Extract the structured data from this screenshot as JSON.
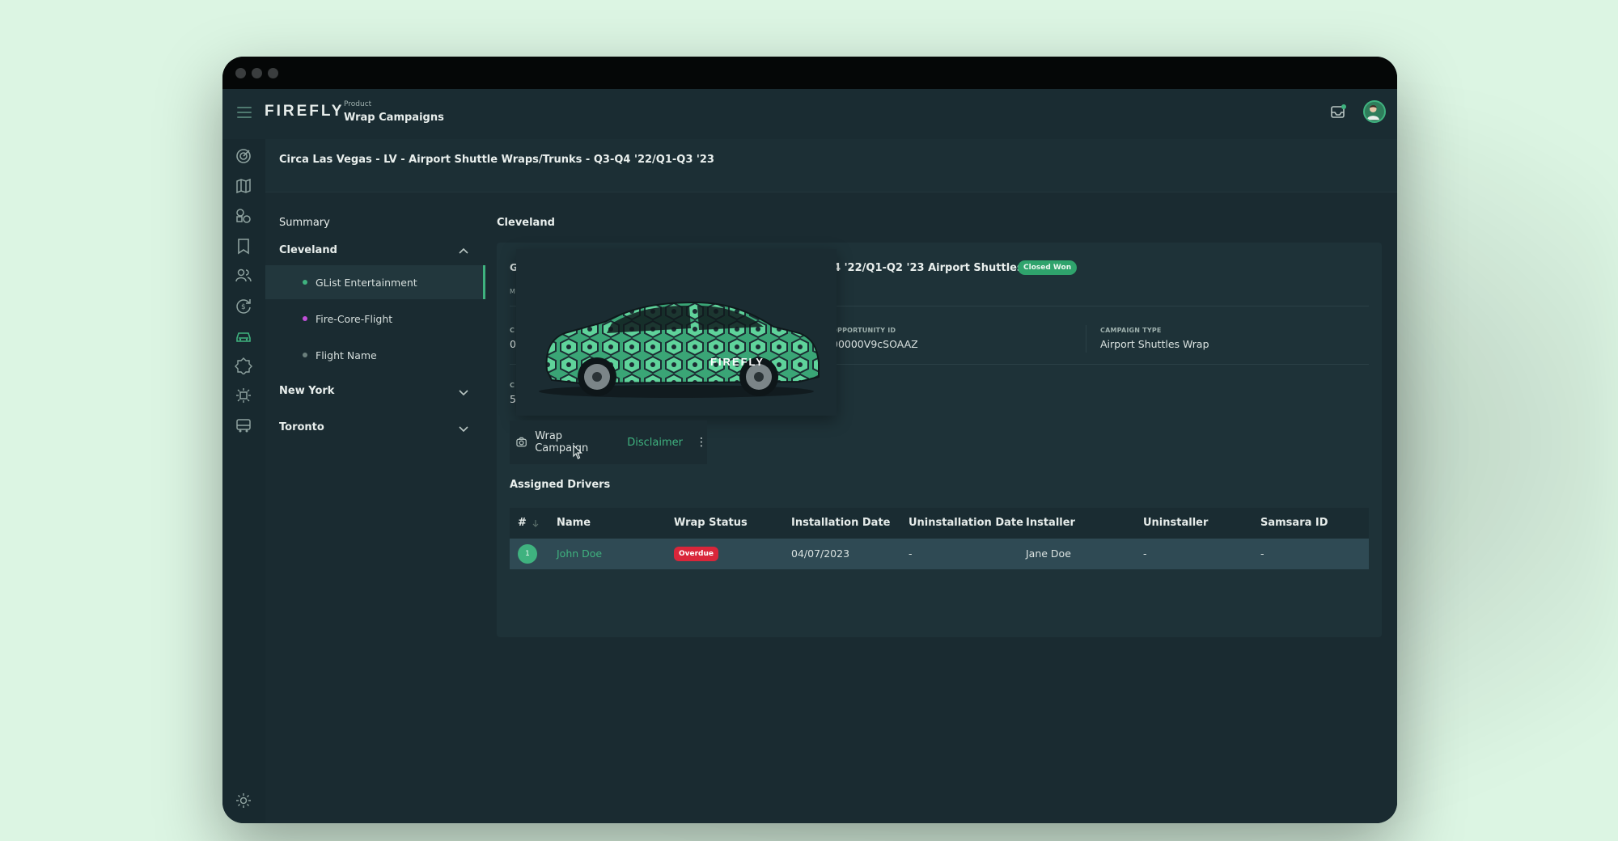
{
  "app": {
    "logo": "FIREFLY",
    "breadcrumb_parent": "Product",
    "breadcrumb_title": "Wrap Campaigns"
  },
  "page": {
    "title": "Circa Las Vegas - LV - Airport Shuttle Wraps/Trunks - Q3-Q4 '22/Q1-Q3 '23"
  },
  "leftnav": {
    "summary": "Summary",
    "groups": [
      {
        "label": "Cleveland",
        "expanded": true,
        "items": [
          {
            "label": "GList Entertainment",
            "dot_color": "#3fb27f",
            "active": true
          },
          {
            "label": "Fire-Core-Flight",
            "dot_color": "#c04fd8"
          },
          {
            "label": "Flight Name",
            "dot_color": "#6b7f7c"
          }
        ]
      },
      {
        "label": "New York",
        "expanded": false
      },
      {
        "label": "Toronto",
        "expanded": false
      }
    ]
  },
  "main": {
    "section_title": "Cleveland",
    "campaign_name_fragment": "4 '22/Q1-Q2 '23 Airport Shuttles Wrap",
    "status_badge": "Closed Won",
    "frag_g": "G",
    "frag_m": "M",
    "frag_c1": "C",
    "frag_0": "0",
    "frag_c2": "C",
    "frag_5": "5",
    "opportunity_label": "OPPORTUNITY ID",
    "opportunity_value": "00000V9cSOAAZ",
    "campaign_type_label": "CAMPAIGN TYPE",
    "campaign_type_value": "Airport Shuttles Wrap",
    "car_brand": "FIREFLY",
    "toolbar": {
      "wrap_campaign": "Wrap Campaign",
      "disclaimer": "Disclaimer",
      "more": "⋮"
    },
    "assigned_title": "Assigned Drivers",
    "table": {
      "columns": [
        "#",
        "Name",
        "Wrap Status",
        "Installation Date",
        "Uninstallation Date",
        "Installer",
        "Uninstaller",
        "Samsara ID"
      ],
      "rows": [
        {
          "num": "1",
          "name": "John Doe",
          "wrap_status": "Overdue",
          "installation_date": "04/07/2023",
          "uninstallation_date": "-",
          "installer": "Jane Doe",
          "uninstaller": "-",
          "samsara_id": "-"
        }
      ]
    }
  },
  "colors": {
    "accent": "#3fb27f",
    "overdue": "#d9263a",
    "background": "#dcf5e3",
    "panel": "#1e3238"
  }
}
